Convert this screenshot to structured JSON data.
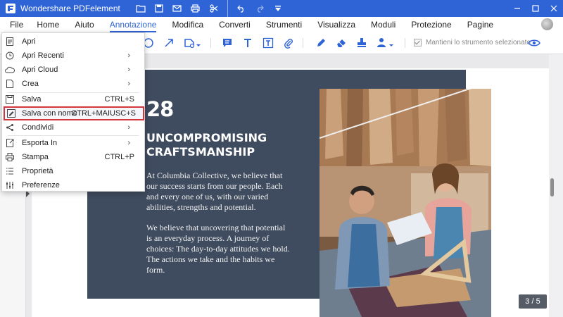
{
  "titlebar": {
    "title": "Wondershare PDFelement"
  },
  "menubar": {
    "file": "File",
    "items": [
      "Home",
      "Aiuto",
      "Annotazione",
      "Modifica",
      "Converti",
      "Strumenti",
      "Visualizza",
      "Moduli",
      "Protezione",
      "Pagine"
    ],
    "active_index": 2
  },
  "toolbar": {
    "keep_tool_label": "Mantieni lo strumento selezionato"
  },
  "file_menu": {
    "items": [
      {
        "label": "Apri",
        "icon": "open-file-icon",
        "shortcut": "",
        "submenu": false
      },
      {
        "label": "Apri Recenti",
        "icon": "clock-icon",
        "shortcut": "",
        "submenu": true
      },
      {
        "label": "Apri Cloud",
        "icon": "cloud-icon",
        "shortcut": "",
        "submenu": true
      },
      {
        "label": "Crea",
        "icon": "new-file-icon",
        "shortcut": "",
        "submenu": true
      },
      {
        "label": "Salva",
        "icon": "save-icon",
        "shortcut": "CTRL+S",
        "submenu": false
      },
      {
        "label": "Salva con nome",
        "icon": "save-as-icon",
        "shortcut": "CTRL+MAIUSC+S",
        "submenu": false,
        "highlighted": true
      },
      {
        "label": "Condividi",
        "icon": "share-icon",
        "shortcut": "",
        "submenu": true
      },
      {
        "label": "Esporta In",
        "icon": "export-icon",
        "shortcut": "",
        "submenu": true
      },
      {
        "label": "Stampa",
        "icon": "print-icon",
        "shortcut": "CTRL+P",
        "submenu": false
      },
      {
        "label": "Proprietà",
        "icon": "list-icon",
        "shortcut": "",
        "submenu": false
      },
      {
        "label": "Preferenze",
        "icon": "sliders-icon",
        "shortcut": "",
        "submenu": false
      }
    ]
  },
  "document": {
    "page_number_big": "28",
    "heading": "UNCOMPROMISING CRAFTSMANSHIP",
    "paragraph1": "At Columbia Collective, we believe that our success starts from our people. Each and every one of us, with our varied abilities, strengths and potential.",
    "paragraph2": "We believe that uncovering that potential is an everyday process. A journey of choices: The day-to-day attitudes we hold. The actions we take and the habits we form."
  },
  "status": {
    "page_indicator": "3 / 5"
  },
  "colors": {
    "accent": "#2f64d6",
    "panel": "#3f4b5e",
    "highlight": "#d4363d"
  }
}
